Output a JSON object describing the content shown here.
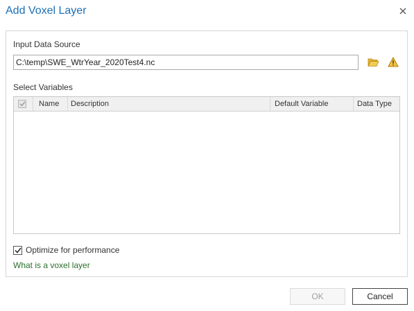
{
  "dialog": {
    "title": "Add Voxel Layer",
    "close_icon": "close-icon"
  },
  "input_source": {
    "label": "Input Data Source",
    "value": "C:\\temp\\SWE_WtrYear_2020Test4.nc",
    "browse_icon": "folder-open-icon",
    "warning_icon": "warning-icon"
  },
  "variables": {
    "label": "Select Variables",
    "columns": [
      "Name",
      "Description",
      "Default Variable",
      "Data Type"
    ],
    "header_checked": true,
    "rows": []
  },
  "optimize": {
    "label": "Optimize for performance",
    "checked": true
  },
  "help_link": "What is a voxel layer",
  "buttons": {
    "ok": "OK",
    "cancel": "Cancel"
  },
  "colors": {
    "title": "#1b6fb5",
    "link": "#2b6e2b",
    "folder": "#d9a520",
    "warning": "#e0a100"
  }
}
